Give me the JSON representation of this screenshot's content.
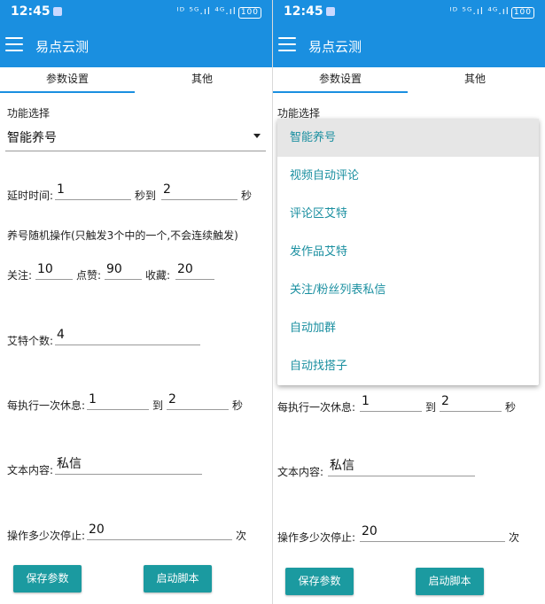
{
  "status": {
    "time": "12:45",
    "sys": "ᴵᴰ ⁵ᴳ.ıl ⁴ᴳ.ıl",
    "battery": "100"
  },
  "app": {
    "title": "易点云测"
  },
  "tabs": [
    {
      "label": "参数设置"
    },
    {
      "label": "其他"
    }
  ],
  "form": {
    "function_label": "功能选择",
    "function_value": "智能养号",
    "delay_label": "延时时间:",
    "delay_from": "1",
    "delay_mid": "秒到",
    "delay_to": "2",
    "delay_unit": "秒",
    "random_note": "养号随机操作(只触发3个中的一个,不会连续触发)",
    "follow_label": "关注:",
    "follow_value": "10",
    "like_label": "点赞:",
    "like_value": "90",
    "fav_label": "收藏:",
    "fav_value": "20",
    "mention_label": "艾特个数:",
    "mention_value": "4",
    "rest_label": "每执行一次休息:",
    "rest_from": "1",
    "rest_mid": "到",
    "rest_to": "2",
    "rest_unit": "秒",
    "text_label": "文本内容:",
    "text_value": "私信",
    "stop_label": "操作多少次停止:",
    "stop_value": "20",
    "stop_unit": "次"
  },
  "buttons": {
    "save": "保存参数",
    "start": "启动脚本"
  },
  "dropdown": {
    "options": [
      "智能养号",
      "视频自动评论",
      "评论区艾特",
      "发作品艾特",
      "关注/粉丝列表私信",
      "自动加群",
      "自动找搭子"
    ],
    "selected_index": 0
  },
  "colors": {
    "primary": "#1a8fe0",
    "button": "#1b9aa0",
    "option_text": "#1a8fa0"
  }
}
